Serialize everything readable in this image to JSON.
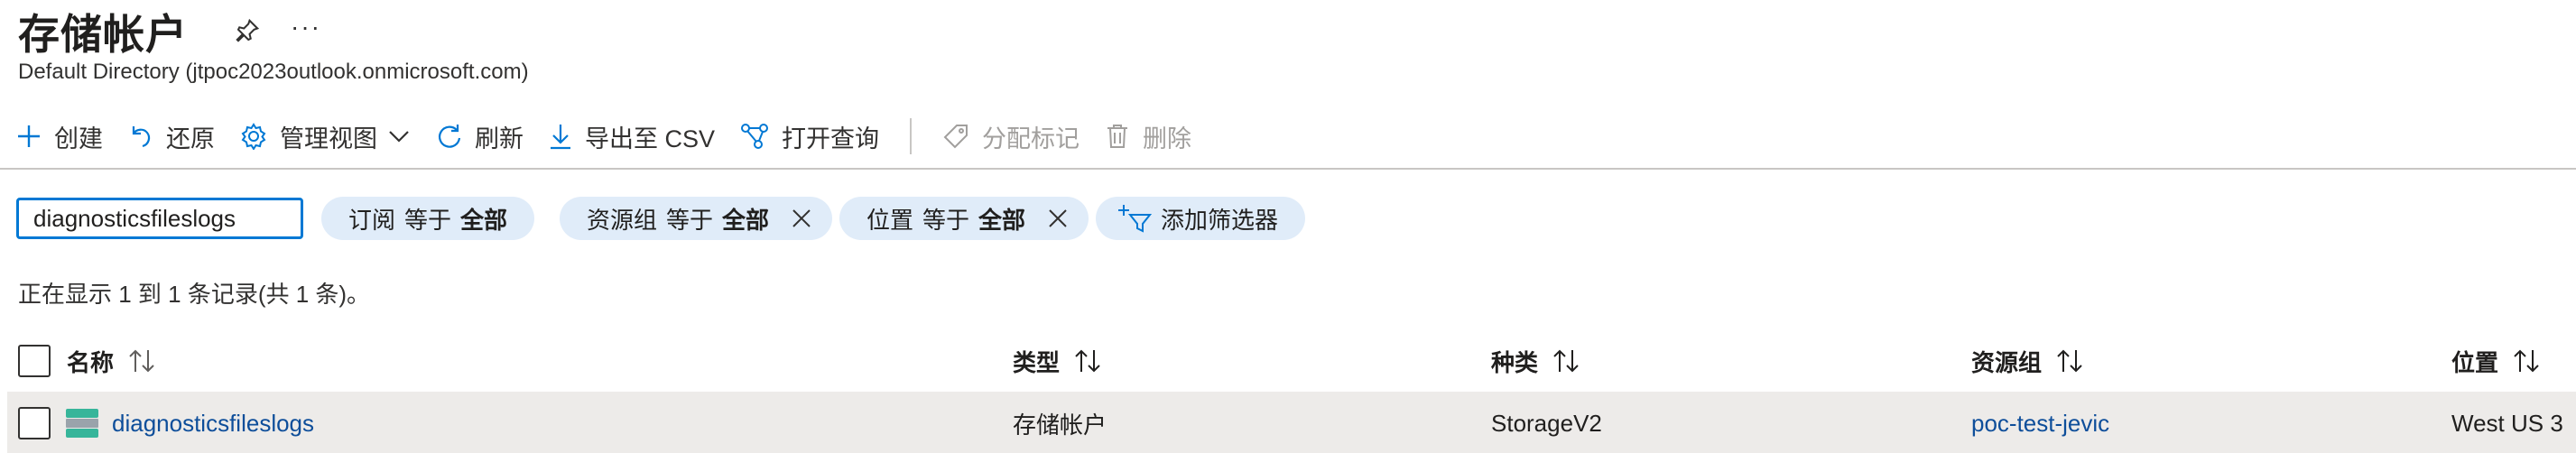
{
  "header": {
    "title": "存储帐户",
    "subtitle": "Default Directory (jtpoc2023outlook.onmicrosoft.com)",
    "more_label": "···"
  },
  "toolbar": {
    "create": "创建",
    "restore": "还原",
    "manage_view": "管理视图",
    "refresh": "刷新",
    "export_csv": "导出至 CSV",
    "open_query": "打开查询",
    "assign_tags": "分配标记",
    "delete": "删除"
  },
  "filters": {
    "search_value": "diagnosticsfileslogs",
    "subscription": {
      "field": "订阅",
      "op": "等于",
      "value": "全部"
    },
    "resource_group": {
      "field": "资源组",
      "op": "等于",
      "value": "全部"
    },
    "location": {
      "field": "位置",
      "op": "等于",
      "value": "全部"
    },
    "add_filter": "添加筛选器"
  },
  "count_text": "正在显示 1 到 1 条记录(共 1 条)。",
  "table": {
    "columns": {
      "name": "名称",
      "type": "类型",
      "kind": "种类",
      "resource_group": "资源组",
      "location": "位置"
    },
    "rows": [
      {
        "name": "diagnosticsfileslogs",
        "type": "存储帐户",
        "kind": "StorageV2",
        "resource_group": "poc-test-jevic",
        "location": "West US 3"
      }
    ]
  },
  "colors": {
    "accent": "#0078d4",
    "link": "#0e4e9a",
    "pill_bg": "#e0ecf9",
    "row_selected_bg": "#edebe9",
    "disabled": "#a19f9d"
  }
}
